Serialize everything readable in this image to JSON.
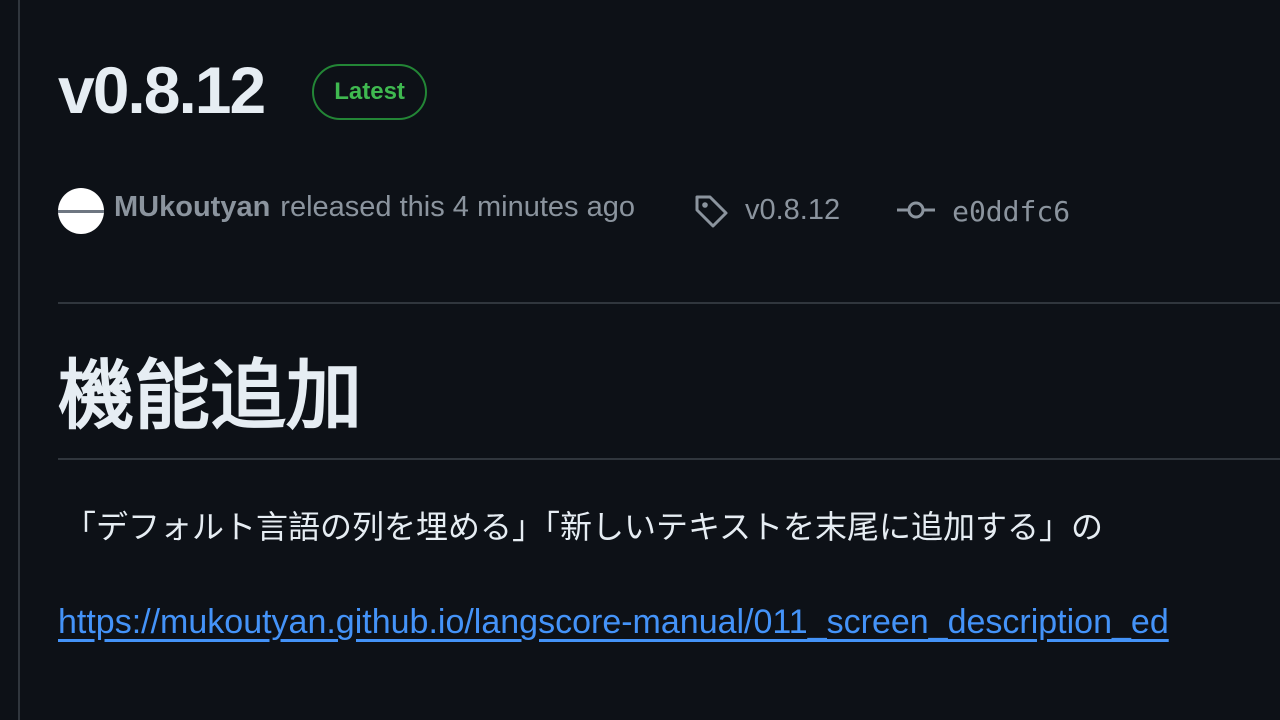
{
  "release": {
    "title": "v0.8.12",
    "badge": "Latest",
    "author": "MUkoutyan",
    "released_text": "released this 4 minutes ago",
    "tag": "v0.8.12",
    "commit": "e0ddfc6"
  },
  "notes": {
    "heading": "機能追加",
    "body": "「デフォルト言語の列を埋める」「新しいテキストを末尾に追加する」の",
    "link": "https://mukoutyan.github.io/langscore-manual/011_screen_description_ed"
  },
  "icons": {
    "tag": "tag-icon",
    "commit": "git-commit-icon"
  },
  "colors": {
    "background": "#0d1117",
    "badge_green": "#3fb950",
    "link_blue": "#4493f8",
    "muted": "#8b949e"
  }
}
